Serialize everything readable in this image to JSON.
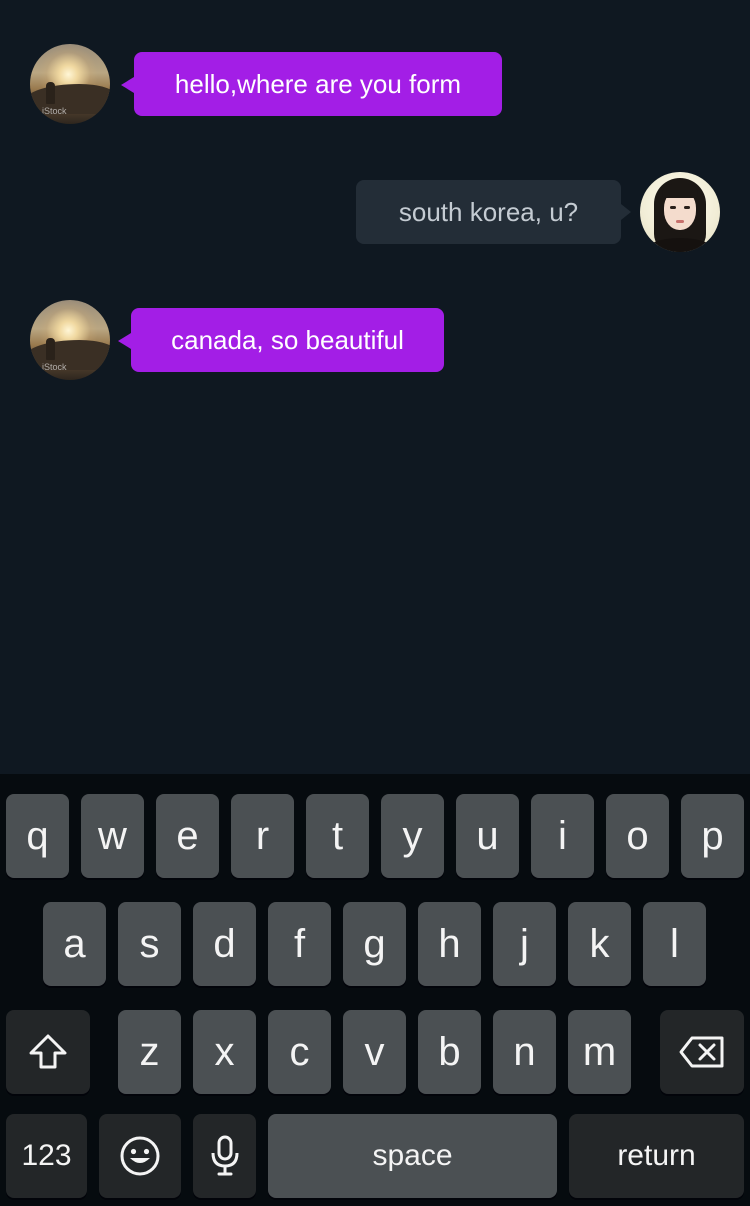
{
  "messages": [
    {
      "side": "left",
      "text": "hello,where are you form",
      "avatar": "landscape-avatar"
    },
    {
      "side": "right",
      "text": "south korea, u?",
      "avatar": "girl-avatar"
    },
    {
      "side": "left",
      "text": "canada, so beautiful",
      "avatar": "landscape-avatar"
    }
  ],
  "avatar_watermark": "iStock",
  "colors": {
    "background": "#0f1821",
    "incoming_bubble": "#a31ee6",
    "outgoing_bubble": "#232d37",
    "keyboard_bg": "#060b0f",
    "key": "#4b5053",
    "key_dark": "#232628"
  },
  "keyboard": {
    "row1": [
      "q",
      "w",
      "e",
      "r",
      "t",
      "y",
      "u",
      "i",
      "o",
      "p"
    ],
    "row2": [
      "a",
      "s",
      "d",
      "f",
      "g",
      "h",
      "j",
      "k",
      "l"
    ],
    "row3": [
      "z",
      "x",
      "c",
      "v",
      "b",
      "n",
      "m"
    ],
    "shift_icon": "shift-arrow-icon",
    "delete_icon": "backspace-icon",
    "numbers_label": "123",
    "emoji_icon": "emoji-smile-icon",
    "mic_icon": "microphone-icon",
    "space_label": "space",
    "return_label": "return"
  }
}
